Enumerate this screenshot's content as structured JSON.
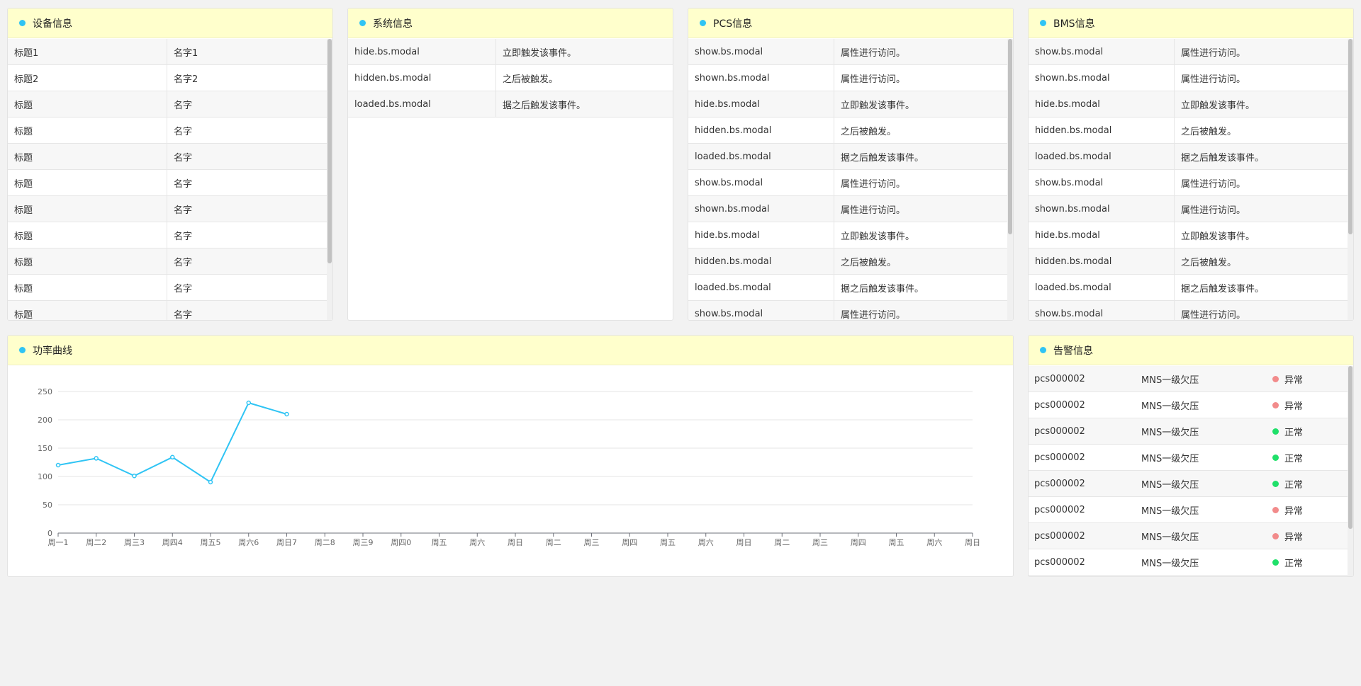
{
  "colors": {
    "header_bg": "#ffffcc",
    "dot": "#2fc4f4",
    "line": "#2fc4f4",
    "abnormal": "#f28b8b",
    "normal": "#20e06a"
  },
  "device": {
    "title": "设备信息",
    "rows": [
      [
        "标题1",
        "名字1"
      ],
      [
        "标题2",
        "名字2"
      ],
      [
        "标题",
        "名字"
      ],
      [
        "标题",
        "名字"
      ],
      [
        "标题",
        "名字"
      ],
      [
        "标题",
        "名字"
      ],
      [
        "标题",
        "名字"
      ],
      [
        "标题",
        "名字"
      ],
      [
        "标题",
        "名字"
      ],
      [
        "标题",
        "名字"
      ],
      [
        "标题",
        "名字"
      ]
    ]
  },
  "system": {
    "title": "系统信息",
    "rows": [
      [
        "hide.bs.modal",
        "立即触发该事件。"
      ],
      [
        "hidden.bs.modal",
        "之后被触发。"
      ],
      [
        "loaded.bs.modal",
        "据之后触发该事件。"
      ]
    ]
  },
  "pcs": {
    "title": "PCS信息",
    "rows": [
      [
        "show.bs.modal",
        "属性进行访问。"
      ],
      [
        "shown.bs.modal",
        "属性进行访问。"
      ],
      [
        "hide.bs.modal",
        "立即触发该事件。"
      ],
      [
        "hidden.bs.modal",
        "之后被触发。"
      ],
      [
        "loaded.bs.modal",
        "据之后触发该事件。"
      ],
      [
        "show.bs.modal",
        "属性进行访问。"
      ],
      [
        "shown.bs.modal",
        "属性进行访问。"
      ],
      [
        "hide.bs.modal",
        "立即触发该事件。"
      ],
      [
        "hidden.bs.modal",
        "之后被触发。"
      ],
      [
        "loaded.bs.modal",
        "据之后触发该事件。"
      ],
      [
        "show.bs.modal",
        "属性进行访问。"
      ]
    ]
  },
  "bms": {
    "title": "BMS信息",
    "rows": [
      [
        "show.bs.modal",
        "属性进行访问。"
      ],
      [
        "shown.bs.modal",
        "属性进行访问。"
      ],
      [
        "hide.bs.modal",
        "立即触发该事件。"
      ],
      [
        "hidden.bs.modal",
        "之后被触发。"
      ],
      [
        "loaded.bs.modal",
        "据之后触发该事件。"
      ],
      [
        "show.bs.modal",
        "属性进行访问。"
      ],
      [
        "shown.bs.modal",
        "属性进行访问。"
      ],
      [
        "hide.bs.modal",
        "立即触发该事件。"
      ],
      [
        "hidden.bs.modal",
        "之后被触发。"
      ],
      [
        "loaded.bs.modal",
        "据之后触发该事件。"
      ],
      [
        "show.bs.modal",
        "属性进行访问。"
      ]
    ]
  },
  "power": {
    "title": "功率曲线"
  },
  "alarm": {
    "title": "告警信息",
    "rows": [
      {
        "id": "pcs000002",
        "msg": "MNS一级欠压",
        "status": "异常",
        "ok": false
      },
      {
        "id": "pcs000002",
        "msg": "MNS一级欠压",
        "status": "异常",
        "ok": false
      },
      {
        "id": "pcs000002",
        "msg": "MNS一级欠压",
        "status": "正常",
        "ok": true
      },
      {
        "id": "pcs000002",
        "msg": "MNS一级欠压",
        "status": "正常",
        "ok": true
      },
      {
        "id": "pcs000002",
        "msg": "MNS一级欠压",
        "status": "正常",
        "ok": true
      },
      {
        "id": "pcs000002",
        "msg": "MNS一级欠压",
        "status": "异常",
        "ok": false
      },
      {
        "id": "pcs000002",
        "msg": "MNS一级欠压",
        "status": "异常",
        "ok": false
      },
      {
        "id": "pcs000002",
        "msg": "MNS一级欠压",
        "status": "正常",
        "ok": true
      }
    ]
  },
  "chart_data": {
    "type": "line",
    "title": "",
    "categories": [
      "周一1",
      "周二2",
      "周三3",
      "周四4",
      "周五5",
      "周六6",
      "周日7",
      "周二8",
      "周三9",
      "周四0",
      "周五",
      "周六",
      "周日",
      "周二",
      "周三",
      "周四",
      "周五",
      "周六",
      "周日",
      "周二",
      "周三",
      "周四",
      "周五",
      "周六",
      "周日"
    ],
    "series": [
      {
        "values": [
          120,
          132,
          101,
          134,
          90,
          230,
          210
        ]
      }
    ],
    "ylim": [
      0,
      250
    ],
    "yticks": [
      0,
      50,
      100,
      150,
      200,
      250
    ],
    "grid": true
  }
}
